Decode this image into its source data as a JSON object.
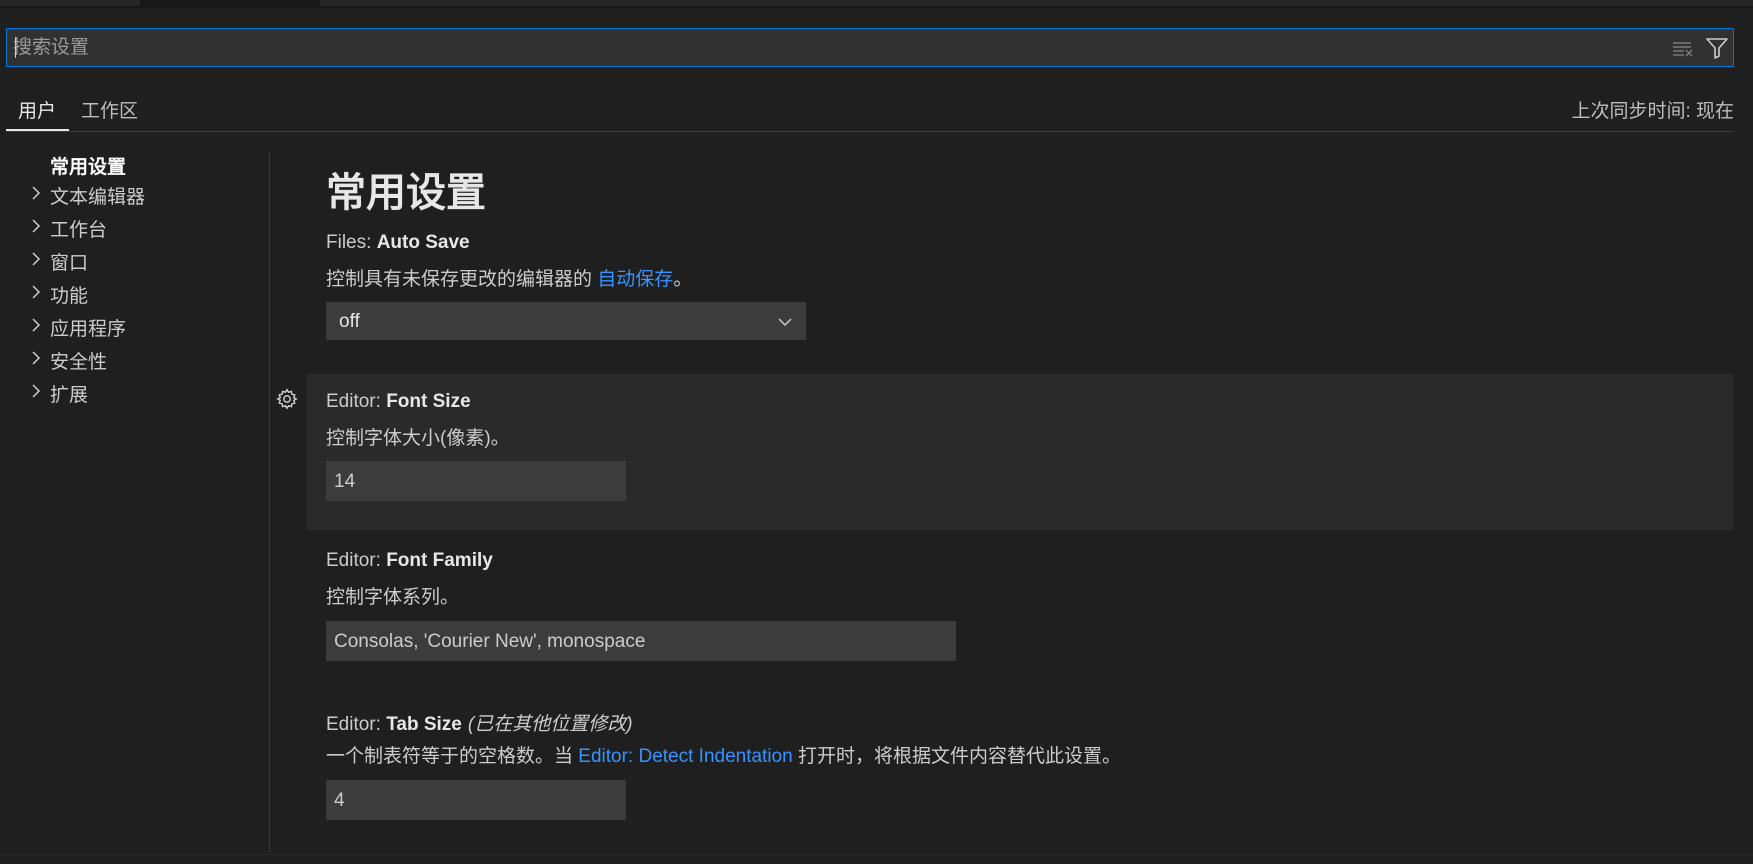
{
  "search": {
    "placeholder": "搜索设置",
    "value": ""
  },
  "tabs": {
    "user": "用户",
    "workspace": "工作区"
  },
  "sync_status": "上次同步时间: 现在",
  "toc": {
    "items": [
      {
        "label": "常用设置"
      },
      {
        "label": "文本编辑器"
      },
      {
        "label": "工作台"
      },
      {
        "label": "窗口"
      },
      {
        "label": "功能"
      },
      {
        "label": "应用程序"
      },
      {
        "label": "安全性"
      },
      {
        "label": "扩展"
      }
    ]
  },
  "page_title": "常用设置",
  "settings": {
    "auto_save": {
      "category": "Files: ",
      "name": "Auto Save",
      "desc_prefix": "控制具有未保存更改的编辑器的 ",
      "desc_link": "自动保存",
      "desc_suffix": "。",
      "value": "off"
    },
    "font_size": {
      "category": "Editor: ",
      "name": "Font Size",
      "desc": "控制字体大小(像素)。",
      "value": "14"
    },
    "font_family": {
      "category": "Editor: ",
      "name": "Font Family",
      "desc": "控制字体系列。",
      "value": "Consolas, 'Courier New', monospace"
    },
    "tab_size": {
      "category": "Editor: ",
      "name": "Tab Size",
      "modified": "(已在其他位置修改)",
      "desc_prefix": "一个制表符等于的空格数。当 ",
      "desc_link": "Editor: Detect Indentation",
      "desc_suffix": " 打开时，将根据文件内容替代此设置。",
      "value": "4"
    }
  },
  "colors": {
    "background": "#1f1f1f",
    "input_background": "#3c3c3c",
    "focus_border": "#0078d4",
    "link": "#3794ff"
  }
}
